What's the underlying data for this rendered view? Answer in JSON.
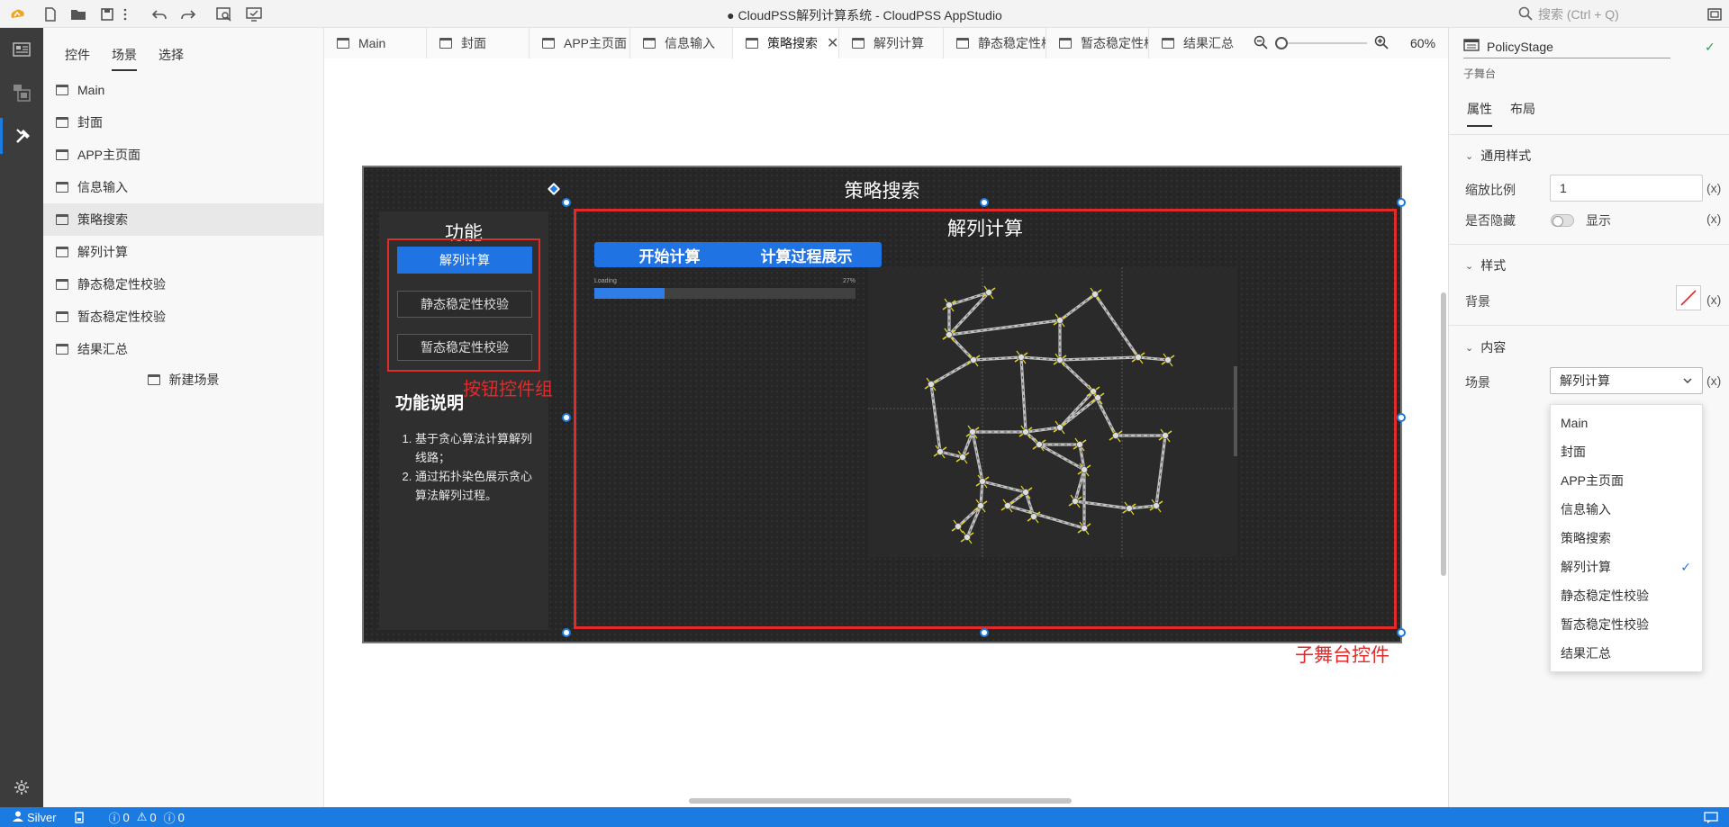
{
  "window": {
    "title": "● CloudPSS解列计算系统 - CloudPSS AppStudio",
    "search_placeholder": "搜索 (Ctrl + Q)"
  },
  "left_panel": {
    "tabs": [
      "控件",
      "场景",
      "选择"
    ],
    "active_tab": "场景",
    "scenes": [
      "Main",
      "封面",
      "APP主页面",
      "信息输入",
      "策略搜索",
      "解列计算",
      "静态稳定性校验",
      "暂态稳定性校验",
      "结果汇总"
    ],
    "active_scene": "策略搜索",
    "new_scene_label": "新建场景"
  },
  "doc_tabs": [
    {
      "label": "Main"
    },
    {
      "label": "封面"
    },
    {
      "label": "APP主页面"
    },
    {
      "label": "信息输入"
    },
    {
      "label": "策略搜索",
      "active": true,
      "close": "✕"
    },
    {
      "label": "解列计算"
    },
    {
      "label": "静态稳定性校"
    },
    {
      "label": "暂态稳定性校"
    },
    {
      "label": "结果汇总"
    }
  ],
  "zoom": {
    "level": "60%",
    "slider_fraction": 0.0
  },
  "stage": {
    "title": "策略搜索",
    "function_panel": {
      "title": "功能",
      "buttons": [
        "解列计算",
        "静态稳定性校验",
        "暂态稳定性校验"
      ],
      "group_label": "按钮控件组",
      "desc_title": "功能说明",
      "desc_items": [
        "基于贪心算法计算解列线路；",
        "通过拓扑染色展示贪心算法解列过程。"
      ]
    },
    "substage": {
      "title": "解列计算",
      "start_button": "开始计算",
      "process_button": "计算过程展示",
      "progress_label": "Loading",
      "progress_text": "27%",
      "progress_value": 0.27
    },
    "substage_label": "子舞台控件"
  },
  "right_panel": {
    "component_name": "PolicyStage",
    "component_type": "子舞台",
    "tabs": [
      "属性",
      "布局"
    ],
    "active_tab": "属性",
    "sections": {
      "general": "通用样式",
      "style": "样式",
      "content": "内容"
    },
    "scale_label": "缩放比例",
    "scale_value": "1",
    "hidden_label": "是否隐藏",
    "hidden_text": "显示",
    "background_label": "背景",
    "scene_label": "场景",
    "scene_value": "解列计算",
    "expr_marker": "(x)",
    "dropdown_options": [
      "Main",
      "封面",
      "APP主页面",
      "信息输入",
      "策略搜索",
      "解列计算",
      "静态稳定性校验",
      "暂态稳定性校验",
      "结果汇总"
    ],
    "dropdown_selected": "解列计算"
  },
  "status_bar": {
    "user": "Silver",
    "errors": "0",
    "warnings": "0",
    "infos": "0"
  },
  "colors": {
    "accent": "#1c7be0",
    "highlight_red": "#e12b2b",
    "stage_bg": "#262626"
  }
}
